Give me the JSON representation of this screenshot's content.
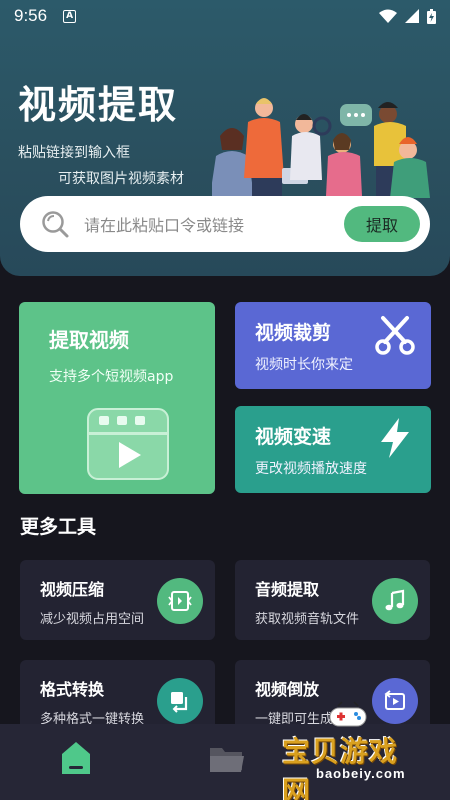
{
  "status_bar": {
    "time": "9:56",
    "notif_glyph": "A"
  },
  "hero": {
    "title": "视频提取",
    "subtitle_line1": "粘贴链接到输入框",
    "subtitle_line2": "可获取图片视频素材"
  },
  "search": {
    "placeholder": "请在此粘贴口令或链接",
    "button_label": "提取"
  },
  "feature_cards": {
    "extract": {
      "title": "提取视频",
      "subtitle": "支持多个短视频app",
      "color": "#5dc389"
    },
    "cut": {
      "title": "视频裁剪",
      "subtitle": "视频时长你来定",
      "color": "#5a68d4"
    },
    "speed": {
      "title": "视频变速",
      "subtitle": "更改视频播放速度",
      "color": "#2a9f8d"
    }
  },
  "more_tools": {
    "title": "更多工具",
    "items": [
      {
        "title": "视频压缩",
        "subtitle": "减少视频占用空间",
        "icon": "compress-icon",
        "icon_color": "#52b97f"
      },
      {
        "title": "音频提取",
        "subtitle": "获取视频音轨文件",
        "icon": "music-note-icon",
        "icon_color": "#52b97f"
      },
      {
        "title": "格式转换",
        "subtitle": "多种格式一键转换",
        "icon": "convert-icon",
        "icon_color": "#2a9f8d"
      },
      {
        "title": "视频倒放",
        "subtitle": "一键即可生成",
        "icon": "reverse-play-icon",
        "icon_color": "#5a68d4"
      }
    ]
  },
  "bottom_nav": {
    "items": [
      {
        "icon": "home-icon",
        "active": true
      },
      {
        "icon": "folder-icon",
        "active": false
      }
    ]
  },
  "watermark": {
    "text": "宝贝游戏网",
    "url": "baobeiy.com"
  }
}
